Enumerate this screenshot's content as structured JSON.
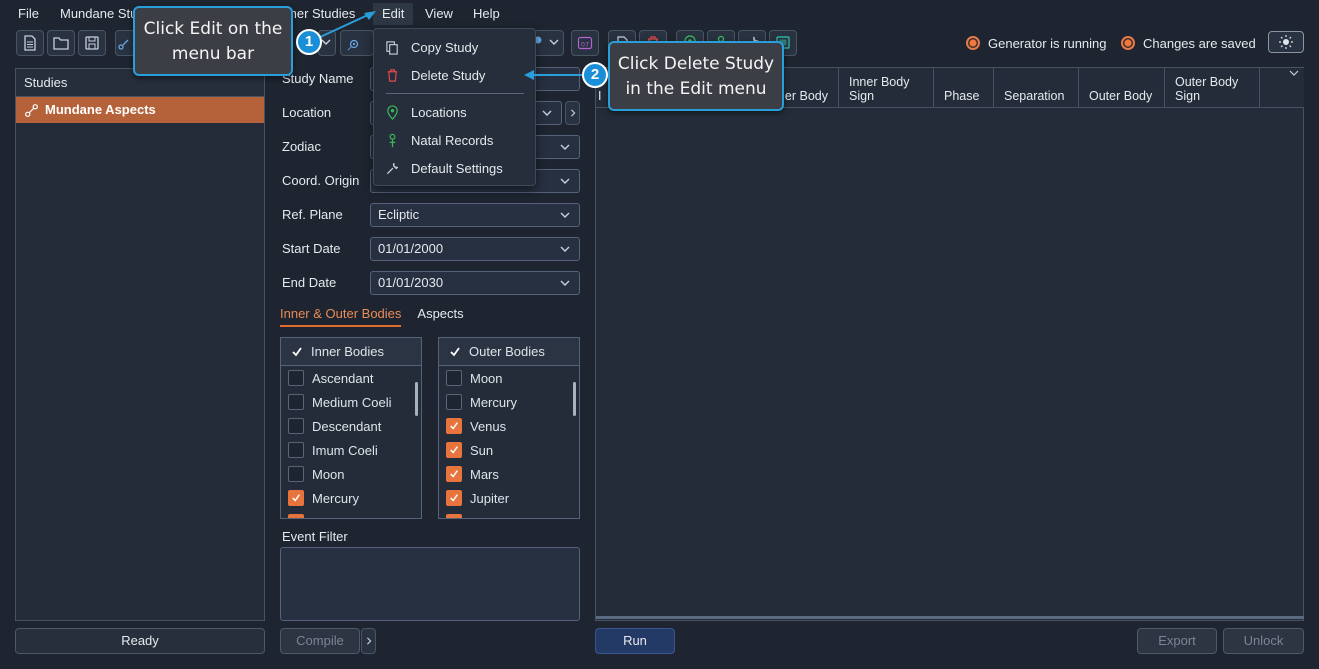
{
  "menubar": {
    "items": [
      "File",
      "Mundane Stu",
      "ther Studies",
      "Edit",
      "View",
      "Help"
    ]
  },
  "status": {
    "generator": "Generator is running",
    "changes": "Changes are saved"
  },
  "studies_panel": {
    "title": "Studies",
    "items": [
      {
        "label": "Mundane Aspects",
        "selected": true
      }
    ],
    "ready_label": "Ready"
  },
  "form": {
    "study_name_label": "Study Name",
    "location_label": "Location",
    "zodiac_label": "Zodiac",
    "coord_origin_label": "Coord. Origin",
    "ref_plane_label": "Ref. Plane",
    "ref_plane_value": "Ecliptic",
    "start_date_label": "Start Date",
    "start_date_value": "01/01/2000",
    "end_date_label": "End Date",
    "end_date_value": "01/01/2030",
    "tabs": [
      "Inner & Outer Bodies",
      "Aspects"
    ],
    "inner_bodies": {
      "title": "Inner Bodies",
      "items": [
        {
          "label": "Ascendant",
          "checked": false
        },
        {
          "label": "Medium Coeli",
          "checked": false
        },
        {
          "label": "Descendant",
          "checked": false
        },
        {
          "label": "Imum Coeli",
          "checked": false
        },
        {
          "label": "Moon",
          "checked": false
        },
        {
          "label": "Mercury",
          "checked": true
        },
        {
          "label": "V",
          "checked": true
        }
      ]
    },
    "outer_bodies": {
      "title": "Outer Bodies",
      "items": [
        {
          "label": "Moon",
          "checked": false
        },
        {
          "label": "Mercury",
          "checked": false
        },
        {
          "label": "Venus",
          "checked": true
        },
        {
          "label": "Sun",
          "checked": true
        },
        {
          "label": "Mars",
          "checked": true
        },
        {
          "label": "Jupiter",
          "checked": true
        },
        {
          "label": "S",
          "checked": true
        }
      ]
    },
    "event_filter_label": "Event Filter",
    "compile_label": "Compile"
  },
  "results_table": {
    "columns": [
      "I",
      "er Body",
      "Inner Body Sign",
      "Phase",
      "Separation",
      "Outer Body",
      "Outer Body Sign"
    ]
  },
  "buttons": {
    "run": "Run",
    "export": "Export",
    "unlock": "Unlock"
  },
  "edit_menu": {
    "items": [
      "Copy Study",
      "Delete Study",
      "Locations",
      "Natal Records",
      "Default Settings"
    ]
  },
  "callouts": {
    "step1_number": "1",
    "step1_text_line1": "Click Edit on the",
    "step1_text_line2": "menu bar",
    "step2_number": "2",
    "step2_text_line1": "Click Delete Study",
    "step2_text_line2": "in the Edit menu"
  },
  "colors": {
    "accent_orange": "#e8743d",
    "callout_border": "#2a9ed8",
    "selected_row": "#b5623a"
  }
}
